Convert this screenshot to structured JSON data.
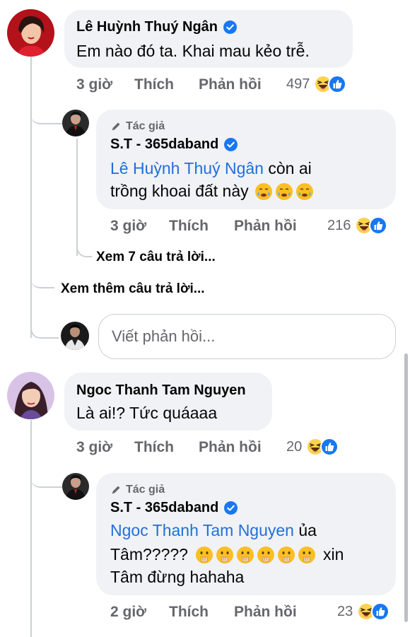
{
  "comments": [
    {
      "author": "Lê Huỳnh Thuý Ngân",
      "text": "Em nào đó ta. Khai mau kẻo trễ.",
      "time": "3 giờ",
      "like_label": "Thích",
      "reply_label": "Phản hồi",
      "reaction_count": "497",
      "reply": {
        "badge": "Tác giả",
        "author": "S.T - 365daband",
        "mention": "Lê Huỳnh Thuý Ngân",
        "text_line1_rest": " còn ai",
        "text_line2": "trồng khoai đất này",
        "time": "3 giờ",
        "like_label": "Thích",
        "reply_label": "Phản hồi",
        "reaction_count": "216"
      },
      "view_replies": "Xem 7 câu trả lời...",
      "view_more": "Xem thêm câu trả lời...",
      "reply_placeholder": "Viết phản hồi..."
    },
    {
      "author": "Ngoc Thanh Tam Nguyen",
      "text": "Là ai!? Tức quáaaa",
      "time": "3 giờ",
      "like_label": "Thích",
      "reply_label": "Phản hồi",
      "reaction_count": "20",
      "reply": {
        "badge": "Tác giả",
        "author": "S.T - 365daband",
        "mention": "Ngoc Thanh Tam Nguyen",
        "text_line1_rest": " ủa",
        "text_line2_start": "Tâm?????",
        "text_line2_end": "xin",
        "text_line3": "Tâm đừng hahaha",
        "time": "2 giờ",
        "like_label": "Thích",
        "reply_label": "Phản hồi",
        "reaction_count": "23"
      }
    }
  ],
  "colors": {
    "bubble": "#f0f2f5",
    "mention": "#216fdb",
    "secondary_text": "#65676b",
    "verified": "#1877f2",
    "thread_line": "#ccd0d5"
  },
  "icons": {
    "verified": "verified-badge-icon",
    "author_badge": "pencil-icon",
    "haha": "haha-reaction-icon",
    "like": "like-reaction-icon",
    "emoji_1": "face-holding-back-tears-emoji",
    "emoji_2": "face-with-hand-over-mouth-emoji"
  }
}
